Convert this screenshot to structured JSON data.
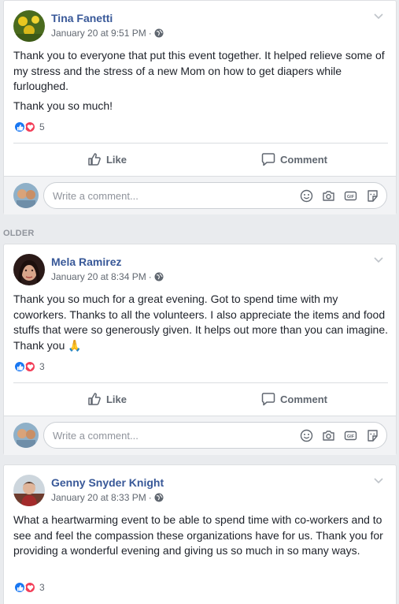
{
  "colors": {
    "page_bg": "#e9ebee",
    "author_link": "#385898",
    "like_blue": "#1877f2",
    "love_red": "#f33e58",
    "muted_text": "#606770"
  },
  "older_label": "OLDER",
  "comment_placeholder": "Write a comment...",
  "actions": {
    "like_label": "Like",
    "comment_label": "Comment"
  },
  "posts": [
    {
      "author": "Tina Fanetti",
      "timestamp": "January 20 at 9:51 PM",
      "separator": "·",
      "paragraphs": [
        "Thank you to everyone that put this event together. It helped relieve some of my stress and the stress of a new Mom on how to get diapers while furloughed.",
        "Thank you so much!"
      ],
      "reaction_count": "5",
      "reaction_icons": [
        "like-icon",
        "love-icon"
      ],
      "privacy_icon": "globe-icon"
    },
    {
      "author": "Mela Ramirez",
      "timestamp": "January 20 at 8:34 PM",
      "separator": "·",
      "paragraphs": [
        "Thank you so much for a great evening. Got to spend time with my coworkers. Thanks to all the volunteers. I also appreciate the items and food stuffs that were so generously given. It helps out more than you can imagine. Thank you 🙏"
      ],
      "reaction_count": "3",
      "reaction_icons": [
        "like-icon",
        "love-icon"
      ],
      "privacy_icon": "globe-icon"
    },
    {
      "author": "Genny Snyder Knight",
      "timestamp": "January 20 at 8:33 PM",
      "separator": "·",
      "paragraphs": [
        "What a heartwarming event to be able to spend time with co-workers and to see and feel the compassion these organizations have for us. Thank you for providing a wonderful evening and giving us so much in so many ways."
      ],
      "reaction_count": "3",
      "reaction_icons": [
        "like-icon",
        "love-icon"
      ],
      "privacy_icon": "globe-icon"
    }
  ],
  "comment_icons": [
    "emoji-icon",
    "camera-icon",
    "gif-icon",
    "sticker-icon"
  ]
}
